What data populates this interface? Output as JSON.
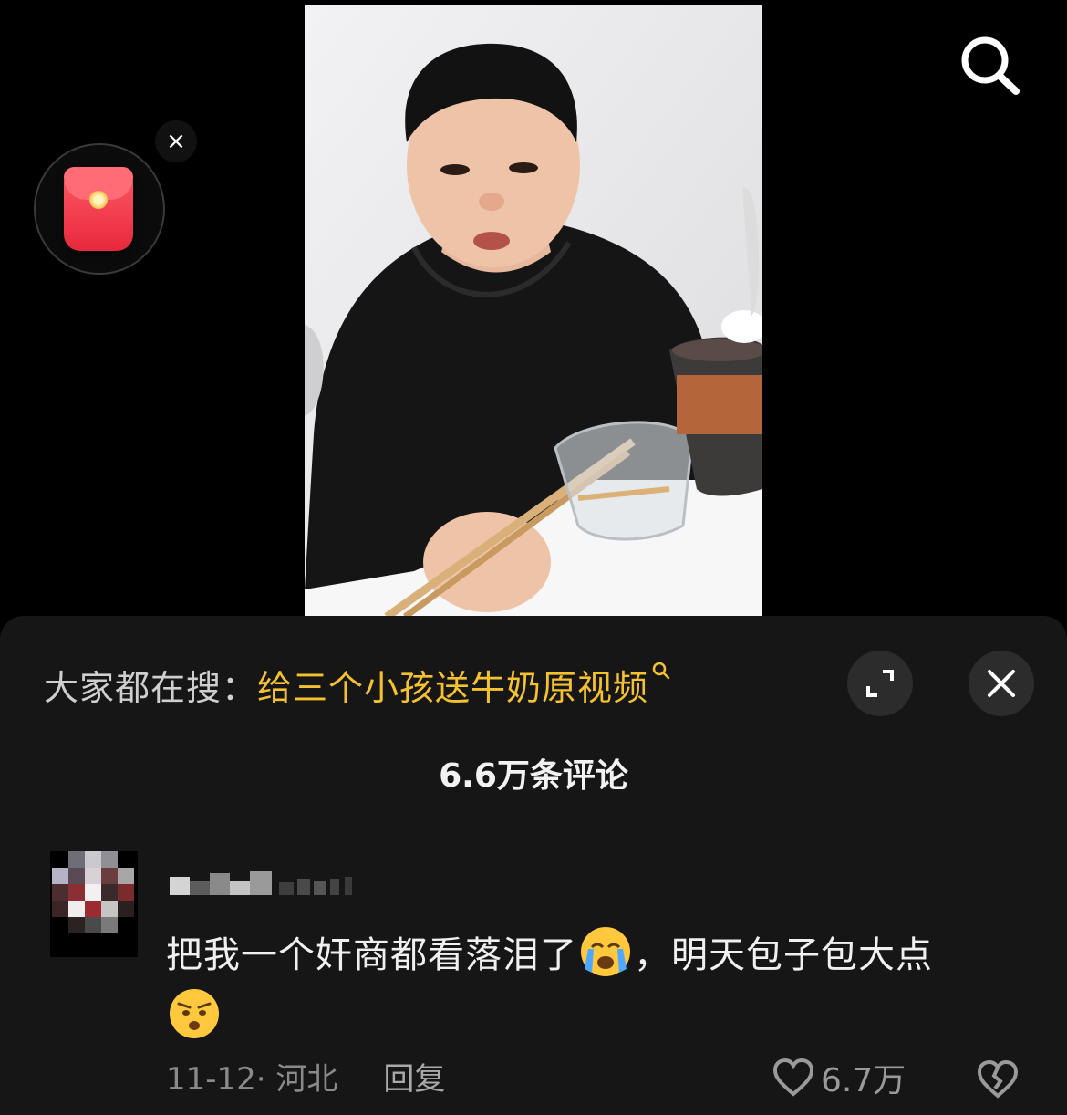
{
  "video": {
    "subject": "boy-eating"
  },
  "search_button": {
    "icon": "search-icon"
  },
  "red_packet": {
    "icon": "red-envelope-icon",
    "close_label": "×"
  },
  "comment_sheet": {
    "hot_search_prefix": "大家都在搜：",
    "hot_search_query": "给三个小孩送牛奶原视频",
    "comment_count": "6.6万条评论",
    "colors": {
      "sheet_bg": "#161616",
      "query": "#f4c12f"
    }
  },
  "comments": [
    {
      "text_before_emoji": "把我一个奸商都看落泪了",
      "text_after_emoji": "，明天包子包大点",
      "date": "11-12",
      "location": "· 河北",
      "reply_label": "回复",
      "like_count": "6.7万",
      "emojis": [
        "crying-face-emoji",
        "worried-face-emoji"
      ]
    }
  ]
}
